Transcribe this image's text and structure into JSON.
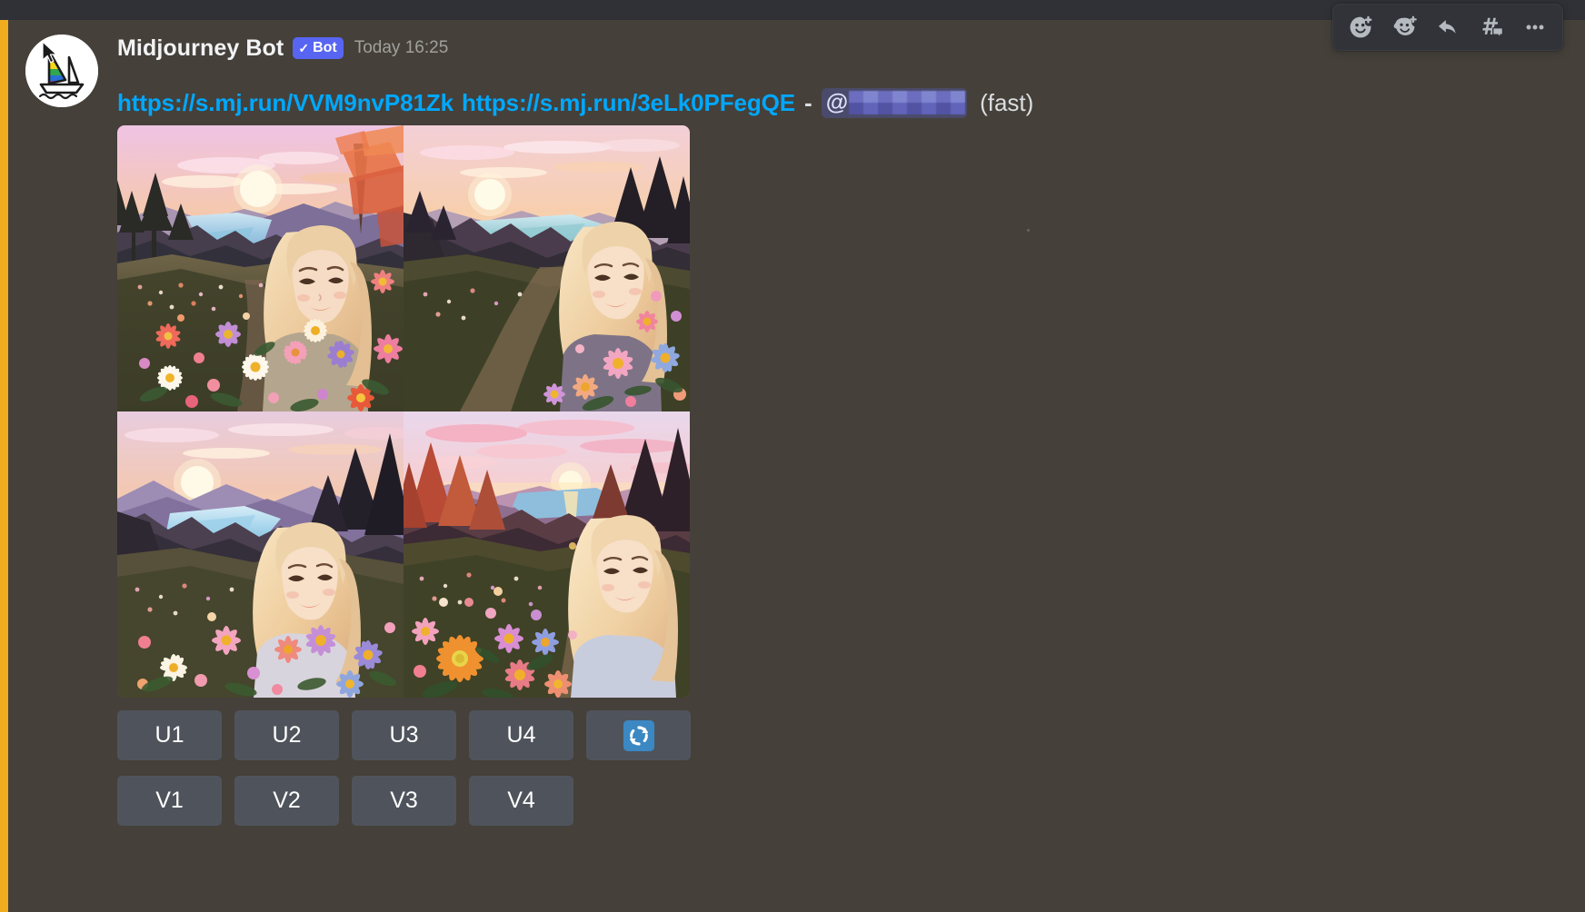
{
  "app": {
    "platform": "discord",
    "theme_colors": {
      "page_background": "#36393f",
      "top_strip": "#2f3136",
      "message_highlight_background": "#45403a",
      "mention_bar": "#f0ad1f",
      "link_blue": "#00a8fc",
      "bot_tag_blue": "#5865f2",
      "button_gray": "#4f545c",
      "toolbar_background": "#313338",
      "reroll_blue": "#3b88c3"
    }
  },
  "message": {
    "author": {
      "name": "Midjourney Bot",
      "avatar_icon": "sailboat-rainbow-avatar"
    },
    "bot_tag": {
      "check": "✓",
      "label": "Bot"
    },
    "timestamp": "Today 16:25",
    "content": {
      "link_1": "https://s.mj.run/VVM9nvP81Zk",
      "link_2": "https://s.mj.run/3eLk0PFegQE",
      "dash": "-",
      "mention_at": "@",
      "mention_user": "",
      "mention_redacted": true,
      "mode": "(fast)"
    }
  },
  "image_grid": {
    "count": 4,
    "images": [
      {
        "index": 1,
        "position": "top-left",
        "alt": "Blonde woman smiling in a sunset flower meadow overlooking a lake and pine forest"
      },
      {
        "index": 2,
        "position": "top-right",
        "alt": "Blonde woman on a flower-lined path with sunset sky and distant lake"
      },
      {
        "index": 3,
        "position": "bottom-left",
        "alt": "Blonde woman on a hillside meadow with lake and purple mountains at sunset"
      },
      {
        "index": 4,
        "position": "bottom-right",
        "alt": "Blonde woman looking back on a flower path with orange daisy and sunset lake"
      }
    ]
  },
  "action_buttons": {
    "upscale_row": [
      {
        "label": "U1"
      },
      {
        "label": "U2"
      },
      {
        "label": "U3"
      },
      {
        "label": "U4"
      }
    ],
    "reroll": {
      "label": "",
      "icon": "refresh-emoji"
    },
    "variation_row": [
      {
        "label": "V1"
      },
      {
        "label": "V2"
      },
      {
        "label": "V3"
      },
      {
        "label": "V4"
      }
    ]
  },
  "hover_toolbar": {
    "buttons": [
      {
        "icon": "add-reaction-icon",
        "tooltip": "Add Reaction"
      },
      {
        "icon": "add-super-reaction-icon",
        "tooltip": "Add Super Reaction"
      },
      {
        "icon": "reply-icon",
        "tooltip": "Reply"
      },
      {
        "icon": "create-thread-icon",
        "tooltip": "Create Thread"
      },
      {
        "icon": "more-options-icon",
        "tooltip": "More"
      }
    ]
  }
}
